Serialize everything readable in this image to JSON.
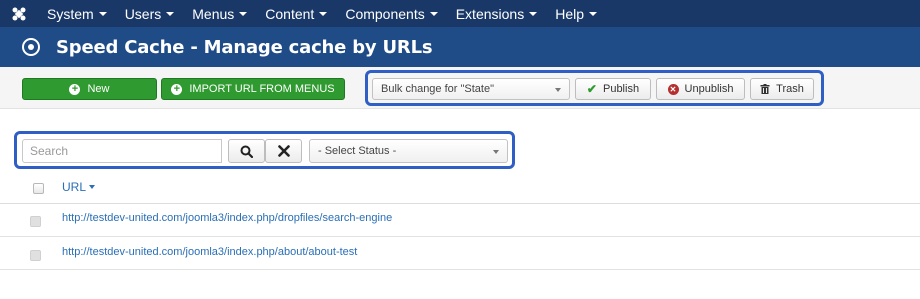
{
  "nav": {
    "items": [
      {
        "label": "System"
      },
      {
        "label": "Users"
      },
      {
        "label": "Menus"
      },
      {
        "label": "Content"
      },
      {
        "label": "Components"
      },
      {
        "label": "Extensions"
      },
      {
        "label": "Help"
      }
    ]
  },
  "header": {
    "title": "Speed Cache - Manage cache by URLs"
  },
  "toolbar": {
    "new_label": "New",
    "import_label": "IMPORT URL FROM MENUS",
    "bulk_select_value": "Bulk change for \"State\"",
    "publish_label": "Publish",
    "unpublish_label": "Unpublish",
    "trash_label": "Trash"
  },
  "filter": {
    "search_placeholder": "Search",
    "status_select_value": "- Select Status -"
  },
  "table": {
    "column_url": "URL",
    "rows": [
      {
        "url": "http://testdev-united.com/joomla3/index.php/dropfiles/search-engine"
      },
      {
        "url": "http://testdev-united.com/joomla3/index.php/about/about-test"
      }
    ]
  },
  "colors": {
    "nav_bg": "#1a3867",
    "title_bg": "#1f4b87",
    "success": "#2f9a2f",
    "highlight": "#2f5ec4",
    "link": "#2a6fb6"
  }
}
